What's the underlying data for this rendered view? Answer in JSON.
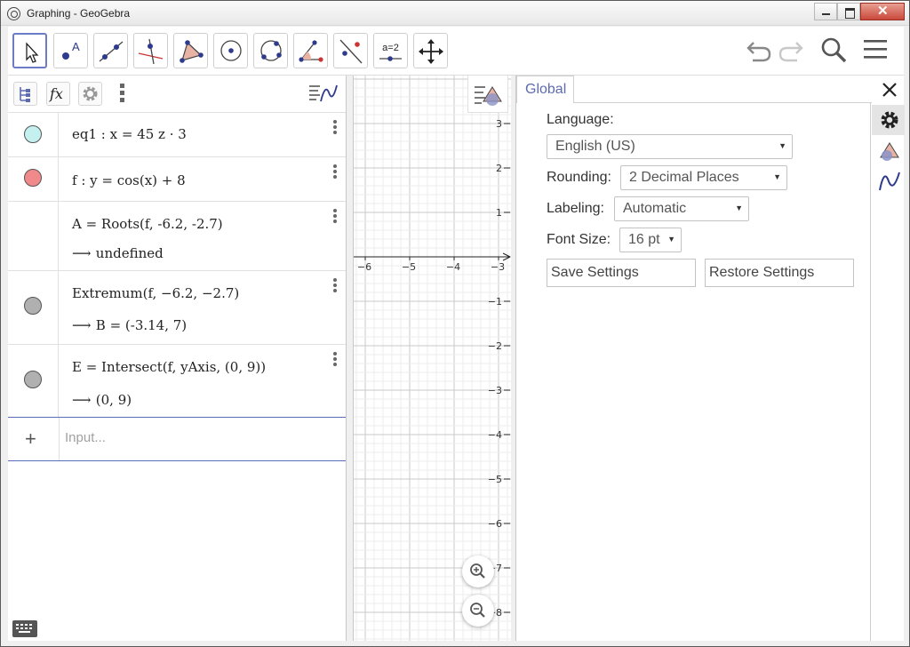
{
  "window": {
    "title": "Graphing - GeoGebra",
    "close_glyph": "✕"
  },
  "toolbar": {
    "tools": [
      {
        "name": "move-tool-icon",
        "selected": true
      },
      {
        "name": "point-tool-icon",
        "label": "A"
      },
      {
        "name": "line-tool-icon"
      },
      {
        "name": "perpendicular-line-tool-icon"
      },
      {
        "name": "polygon-tool-icon"
      },
      {
        "name": "circle-center-point-tool-icon"
      },
      {
        "name": "circle-three-points-tool-icon"
      },
      {
        "name": "angle-tool-icon"
      },
      {
        "name": "reflect-tool-icon"
      },
      {
        "name": "slider-tool-icon",
        "label": "a=2"
      },
      {
        "name": "move-graphics-view-tool-icon"
      }
    ],
    "right": [
      "undo-icon",
      "redo-icon",
      "search-icon",
      "menu-icon"
    ]
  },
  "algebra": {
    "header_icons": [
      "algebra-sort-icon",
      "function-fx-icon",
      "settings-gear-icon",
      "more-vertical-icon",
      "graphics-style-icon"
    ],
    "fx_label": "fx",
    "rows": [
      {
        "expr": "eq1 :  x = 45 z · 3",
        "marble_color": "#c4f0f0"
      },
      {
        "expr": "f :  y = cos(x) + 8",
        "marble_color": "#f08a8a"
      },
      {
        "expr": "A = Roots(f, -6.2, -2.7)",
        "output": "undefined"
      },
      {
        "expr": "Extremum(f, −6.2, −2.7)",
        "output": "B = (-3.14, 7)",
        "marble_color": "#b0b0b0"
      },
      {
        "expr": "E = Intersect(f, yAxis, (0, 9))",
        "output": "(0, 9)",
        "marble_color": "#b0b0b0"
      }
    ],
    "arrow": "⟶",
    "input_placeholder": "Input...",
    "plus": "+"
  },
  "graphics": {
    "x_ticks": [
      "−6",
      "−5",
      "−4",
      "−3"
    ],
    "y_ticks": [
      "3",
      "2",
      "1",
      "−1",
      "−2",
      "−3",
      "−4",
      "−5",
      "−6",
      "−7",
      "−8"
    ]
  },
  "settings": {
    "tab_label": "Global",
    "language_label": "Language:",
    "language_value": "English (US)",
    "rounding_label": "Rounding:",
    "rounding_value": "2 Decimal Places",
    "labeling_label": "Labeling:",
    "labeling_value": "Automatic",
    "fontsize_label": "Font Size:",
    "fontsize_value": "16 pt",
    "save_label": "Save Settings",
    "restore_label": "Restore Settings",
    "caret": "▼"
  },
  "colors": {
    "accent": "#5d6bb0",
    "selected_tool_border": "#6b7bc4"
  }
}
